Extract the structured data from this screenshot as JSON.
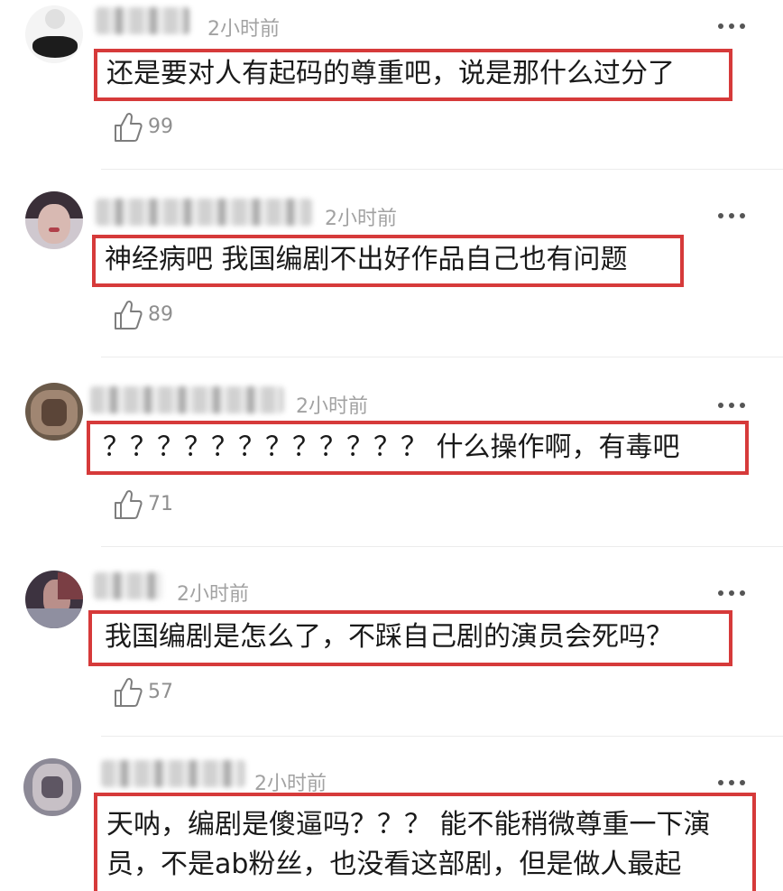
{
  "comments": [
    {
      "time": "2小时前",
      "text": "还是要对人有起码的尊重吧，说是那什么过分了",
      "likes": "99"
    },
    {
      "time": "2小时前",
      "text": "神经病吧 我国编剧不出好作品自己也有问题",
      "likes": "89"
    },
    {
      "time": "2小时前",
      "text": "？？？？？？？？？？？？ 什么操作啊，有毒吧",
      "likes": "71"
    },
    {
      "time": "2小时前",
      "text": "我国编剧是怎么了，不踩自己剧的演员会死吗？",
      "likes": "57"
    },
    {
      "time": "2小时前",
      "text_line1": "天呐，编剧是傻逼吗？？？ 能不能稍微尊重一下演",
      "text_line2": "员，不是ab粉丝，也没看这部剧，但是做人最起"
    }
  ],
  "icons": {
    "like": "thumbs-up-icon",
    "more": "more-dots-icon"
  },
  "colors": {
    "highlight_border": "#d63a3a",
    "muted_text": "#a2a2a2"
  }
}
